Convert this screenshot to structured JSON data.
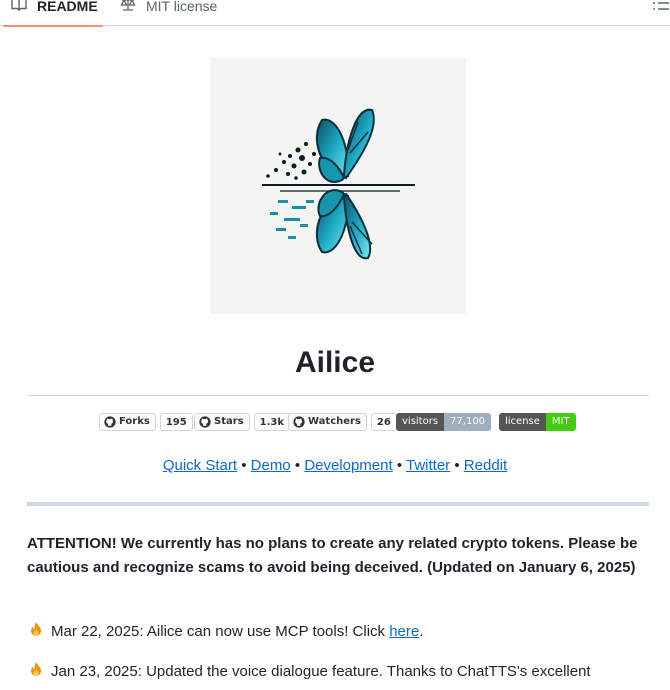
{
  "tabs": [
    {
      "label": "README",
      "icon": "book-icon",
      "active": true
    },
    {
      "label": "MIT license",
      "icon": "law-scale-icon",
      "active": false
    }
  ],
  "readme": {
    "title": "Ailice",
    "badges": [
      {
        "label": "Forks",
        "count": "195"
      },
      {
        "label": "Stars",
        "count": "1.3k"
      },
      {
        "label": "Watchers",
        "count": "26"
      },
      {
        "label": "visitors",
        "value": "77,100",
        "color": "#a0aec0"
      },
      {
        "label": "license",
        "value": "MIT",
        "color": "#4c1"
      }
    ],
    "links": [
      "Quick Start",
      "Demo",
      "Development",
      "Twitter",
      "Reddit"
    ],
    "separator": "•",
    "attention": "ATTENTION! We currently has no plans to create any related crypto tokens. Please be cautious and recognize scams to avoid being deceived. (Updated on January 6, 2025)",
    "news": [
      {
        "text": "Mar 22, 2025: Ailice can now use MCP tools! Click ",
        "link": "here",
        "after": "."
      },
      {
        "text": "Jan 23, 2025: Updated the voice dialogue feature. Thanks to ChatTTS's excellent"
      }
    ]
  },
  "colors": {
    "link": "#0969da",
    "accent_underline": "#fd8c73",
    "teal": "#1a9cb0"
  }
}
